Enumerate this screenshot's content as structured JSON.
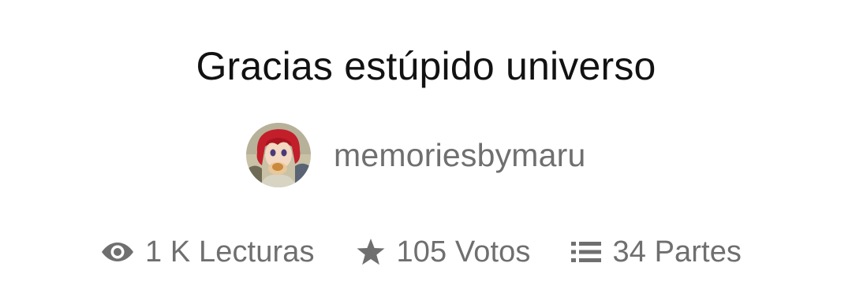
{
  "story": {
    "title": "Gracias estúpido universo"
  },
  "author": {
    "username": "memoriesbymaru",
    "avatar_icon": "avatar-anime-red-hair"
  },
  "stats": {
    "reads": {
      "icon": "eye-icon",
      "label": "1 K Lecturas"
    },
    "votes": {
      "icon": "star-icon",
      "label": "105 Votos"
    },
    "parts": {
      "icon": "list-icon",
      "label": "34 Partes"
    }
  },
  "colors": {
    "title": "#121212",
    "secondary_text": "#6f6f6f",
    "icon": "#6f6f6f",
    "background": "#ffffff"
  }
}
